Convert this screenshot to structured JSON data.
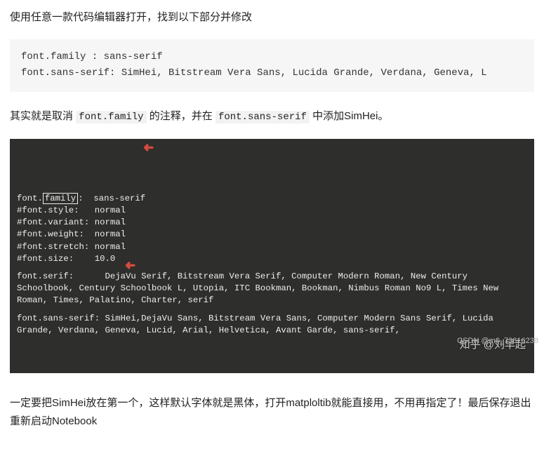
{
  "intro": "使用任意一款代码编辑器打开，找到以下部分并修改",
  "lightCode": {
    "line1": "font.family : sans-serif",
    "line2": "font.sans-serif: SimHei, Bitstream Vera Sans, Lucida Grande, Verdana, Geneva, L"
  },
  "mid": {
    "p1": "其实就是取消 ",
    "c1": "font.family",
    "p2": " 的注释，并在 ",
    "c2": "font.sans-serif",
    "p3": " 中添加SimHei。"
  },
  "dark": {
    "g1_prefix": "font.",
    "g1_boxed": "family",
    "g1_suffix": ":  sans-serif",
    "g1_l2": "#font.style:   normal",
    "g1_l3": "#font.variant: normal",
    "g1_l4": "#font.weight:  normal",
    "g1_l5": "#font.stretch: normal",
    "g1_l6": "#font.size:    10.0",
    "g2": "font.serif:      DejaVu Serif, Bitstream Vera Serif, Computer Modern Roman, New Century Schoolbook, Century Schoolbook L, Utopia, ITC Bookman, Bookman, Nimbus Roman No9 L, Times New Roman, Times, Palatino, Charter, serif",
    "g3": "font.sans-serif: SimHei,DejaVu Sans, Bitstream Vera Sans, Computer Modern Sans Serif, Lucida Grande, Verdana, Geneva, Lucid, Arial, Helvetica, Avant Garde, sans-serif,"
  },
  "arrowGlyph": "➜",
  "watermark": "知乎 @刘早起",
  "outro": "一定要把SimHei放在第一个，这样默认字体就是黑体，打开matploltib就能直接用，不用再指定了！最后保存退出重新启动Notebook",
  "footer": "CSDN @m0_73816238"
}
